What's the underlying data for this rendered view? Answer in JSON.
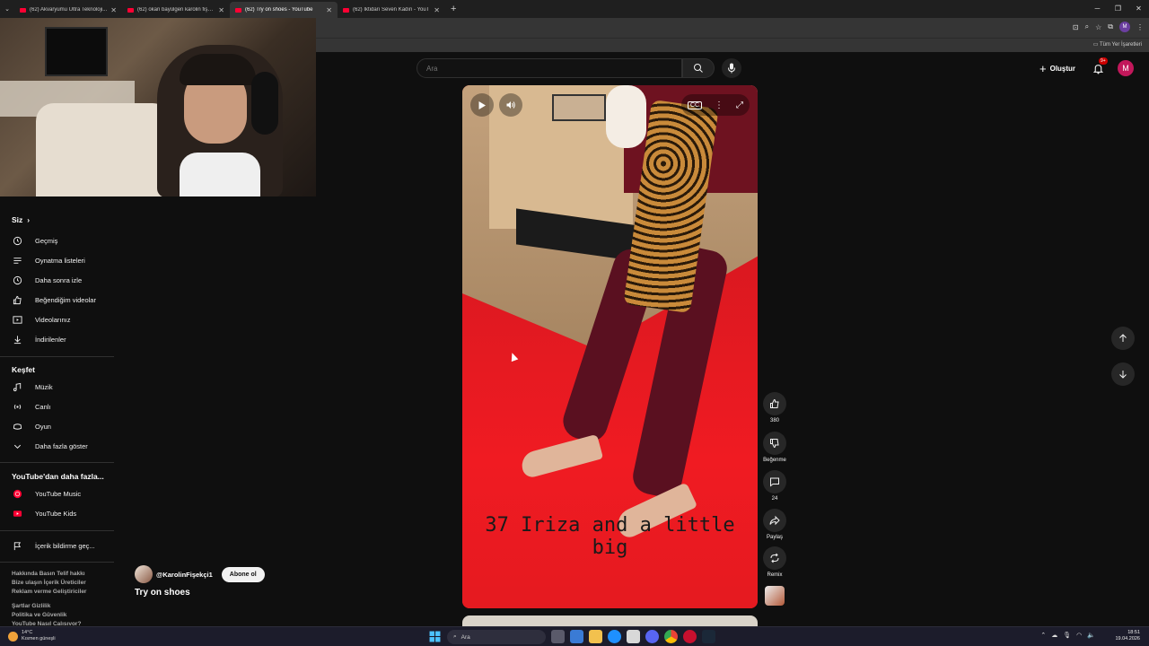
{
  "browser": {
    "tabs": [
      {
        "title": "(62) Akvaryumu Ultra Teknoloji...",
        "active": false
      },
      {
        "title": "(62) okan bayülgen karolin fişe...",
        "active": false
      },
      {
        "title": "(62) Try on shoes - YouTube",
        "active": true
      },
      {
        "title": "(62) İktidarı Seven Kadın - YouT",
        "active": false
      }
    ],
    "bookmarks_all": "Tüm Yer İşaretleri",
    "profile_initial": "M"
  },
  "masthead": {
    "search_placeholder": "Ara",
    "create_label": "Oluştur",
    "notif_badge": "9+",
    "avatar_initial": "M"
  },
  "sidebar": {
    "you_title": "Siz",
    "you_items": [
      {
        "label": "Geçmiş",
        "icon": "history-icon"
      },
      {
        "label": "Oynatma listeleri",
        "icon": "playlist-icon"
      },
      {
        "label": "Daha sonra izle",
        "icon": "watch-later-icon"
      },
      {
        "label": "Beğendiğim videolar",
        "icon": "like-icon"
      },
      {
        "label": "Videolarınız",
        "icon": "your-videos-icon"
      },
      {
        "label": "İndirilenler",
        "icon": "download-icon"
      }
    ],
    "explore_title": "Keşfet",
    "explore_items": [
      {
        "label": "Müzik",
        "icon": "music-icon"
      },
      {
        "label": "Canlı",
        "icon": "live-icon"
      },
      {
        "label": "Oyun",
        "icon": "gaming-icon"
      },
      {
        "label": "Daha fazla göster",
        "icon": "chevron-down-icon"
      }
    ],
    "more_title": "YouTube'dan daha fazla...",
    "more_items": [
      {
        "label": "YouTube Music",
        "icon": "youtube-music-icon"
      },
      {
        "label": "YouTube Kids",
        "icon": "youtube-kids-icon"
      }
    ],
    "report_item": {
      "label": "İçerik bildirme geç...",
      "icon": "flag-icon"
    },
    "footer_lines": [
      "Hakkında  Basın  Telif hakkı",
      "Bize ulaşın  İçerik Üreticiler",
      "Reklam verme  Geliştiriciler",
      "",
      "Şartlar  Gizlilik",
      "Politika ve Güvenlik",
      "YouTube Nasıl Çalışıyor?"
    ]
  },
  "short": {
    "caption": "37 Iriza and a little big",
    "channel": "@KarolinFişekçi1",
    "subscribe_label": "Abone ol",
    "title": "Try on shoes"
  },
  "actions": {
    "like_count": "380",
    "dislike_label": "Beğenme",
    "comment_count": "24",
    "share_label": "Paylaş",
    "remix_label": "Remix"
  },
  "taskbar": {
    "weather_temp": "14°C",
    "weather_desc": "Kısmen güneşli",
    "search_label": "Ara",
    "time": "18:51",
    "date": "19.04.2026"
  }
}
